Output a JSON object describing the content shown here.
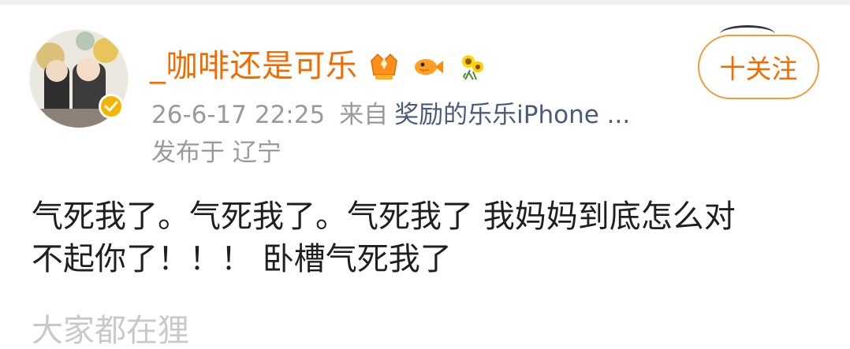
{
  "post": {
    "username": "_咖啡还是可乐",
    "timestamp": "26-6-17 22:25",
    "from_label": "来自",
    "source": "奖励的乐乐iPhone ...",
    "location": "发布于 辽宁",
    "follow_label": "十关注",
    "content": "气死我了。气死我了。气死我了 我妈妈到底怎么对\n不起你了！！！ 卧槽气死我了",
    "partial_text": "大家都在狸"
  },
  "icons": {
    "avatar": "avatar-image",
    "verified": "verified-badge-icon",
    "badge_1": "crown-badge-icon",
    "badge_2": "fish-badge-icon",
    "badge_3": "sunflower-badge-icon"
  },
  "colors": {
    "username": "#f26b00",
    "follow_border": "#f39b3a",
    "meta": "#9a9a9a",
    "source": "#4a5a7a",
    "text": "#1f1f1f",
    "verified": "#f2b500"
  }
}
